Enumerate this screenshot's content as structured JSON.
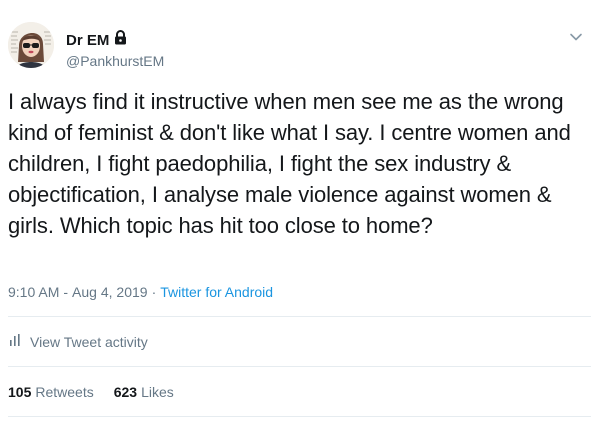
{
  "author": {
    "display_name": "Dr EM",
    "handle": "@PankhurstEM"
  },
  "tweet": {
    "text": "I always find it instructive when men see me as the wrong kind of feminist & don't like what I say. I centre women and children, I fight paedophilia, I fight the sex industry & objectification, I analyse male violence against women & girls. Which topic has hit too close to home?",
    "time": "9:10 AM",
    "date": "Aug 4, 2019",
    "separator_1": "-",
    "separator_2": "·",
    "source": "Twitter for Android"
  },
  "activity": {
    "label": "View Tweet activity"
  },
  "stats": {
    "retweets_count": "105",
    "retweets_label": "Retweets",
    "likes_count": "623",
    "likes_label": "Likes"
  },
  "icons": {
    "lock": "lock-icon",
    "chevron": "chevron-down-icon",
    "activity": "bar-chart-icon"
  },
  "colors": {
    "text": "#14171a",
    "muted": "#657786",
    "link": "#1b95e0",
    "divider": "#e6ecf0"
  }
}
